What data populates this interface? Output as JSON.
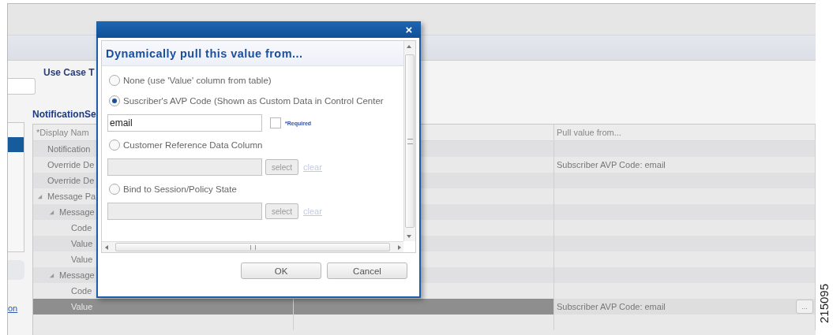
{
  "page": {
    "use_case_label": "Use Case T",
    "section_label": "NotificationSe",
    "link_fragment": "on"
  },
  "table": {
    "column_1": "*Display Nam",
    "column_3": "Pull value from...",
    "rows": [
      {
        "label": "Notification",
        "selected": false
      },
      {
        "label": "Override De",
        "selected": false,
        "pull": "Subscriber AVP Code: email"
      },
      {
        "label": "Override De",
        "selected": false
      },
      {
        "label": "Message Pa",
        "selected": false,
        "expanded": true,
        "children": [
          {
            "label": "Message",
            "selected": false,
            "expanded": true,
            "children": [
              {
                "label": "Code",
                "selected": false
              },
              {
                "label": "Value",
                "selected": false
              },
              {
                "label": "Value",
                "selected": false
              }
            ]
          },
          {
            "label": "Message",
            "selected": false,
            "expanded": true,
            "children": [
              {
                "label": "Code",
                "selected": false
              },
              {
                "label": "Value",
                "selected": true,
                "pull": "Subscriber AVP Code: email",
                "more_button": "..."
              }
            ]
          }
        ]
      }
    ]
  },
  "dialog": {
    "close": "×",
    "heading": "Dynamically pull this value from...",
    "options": [
      {
        "kind": "plain",
        "label": "None (use 'Value' column from table)",
        "selected": false
      },
      {
        "kind": "code_field",
        "label": "Suscriber's AVP Code (Shown as Custom Data in Control Center",
        "selected": true,
        "value": "email",
        "required": {
          "label": "*Required",
          "checked": false
        }
      },
      {
        "kind": "lookup_field",
        "label": "Customer Reference Data Column",
        "selected": false,
        "disabled": true,
        "select_button": "select",
        "clear_link": "clear"
      },
      {
        "kind": "lookup_field",
        "label": "Bind to Session/Policy State",
        "selected": false,
        "disabled": true,
        "select_button": "select",
        "clear_link": "clear"
      }
    ],
    "buttons": [
      {
        "label": "OK"
      },
      {
        "label": "Cancel"
      }
    ]
  },
  "figure_id": "215095"
}
